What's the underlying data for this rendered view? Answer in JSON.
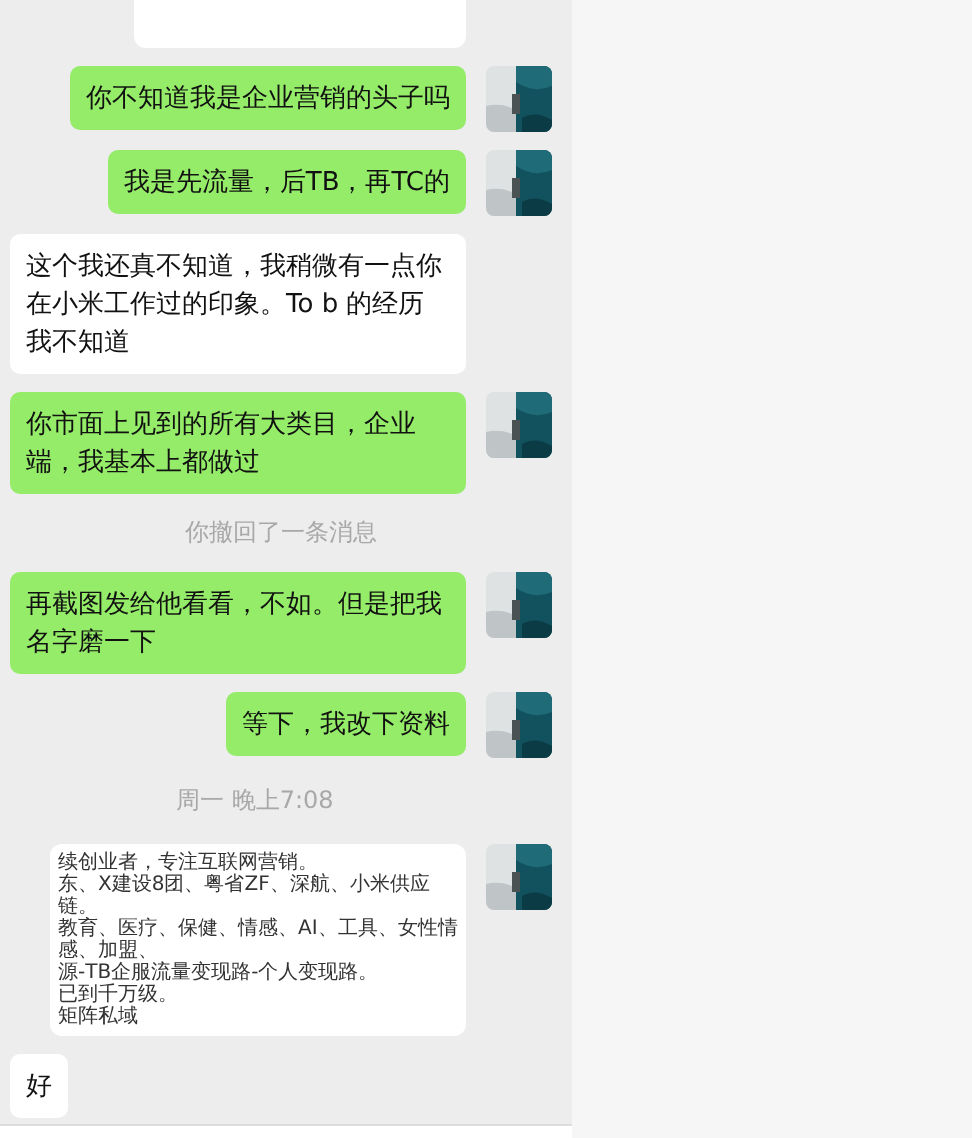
{
  "messages": [
    {
      "kind": "sent_blank"
    },
    {
      "kind": "sent",
      "text": "你不知道我是企业营销的头子吗"
    },
    {
      "kind": "sent",
      "text": "我是先流量，后TB，再TC的"
    },
    {
      "kind": "received",
      "text": "这个我还真不知道，我稍微有一点你在小米工作过的印象。To b 的经历我不知道"
    },
    {
      "kind": "sent",
      "text": "你市面上见到的所有大类目，企业端，我基本上都做过"
    },
    {
      "kind": "notice",
      "text": "你撤回了一条消息"
    },
    {
      "kind": "sent",
      "text": "再截图发给他看看，不如。但是把我名字磨一下"
    },
    {
      "kind": "sent",
      "text": "等下，我改下资料"
    },
    {
      "kind": "time",
      "text": "周一 晚上7:08"
    },
    {
      "kind": "sent_document",
      "lines": [
        "续创业者，专注互联网营销。",
        "东、X建设8团、粤省ZF、深航、小米供应链。",
        "教育、医疗、保健、情感、AI、工具、女性情感、加盟、",
        "源-TB企服流量变现路-个人变现路。",
        "已到千万级。",
        "矩阵私域"
      ]
    },
    {
      "kind": "received",
      "text": "好"
    }
  ]
}
